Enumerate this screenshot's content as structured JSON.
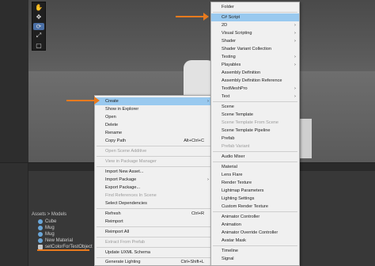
{
  "scene": {
    "tools": [
      "hand-tool-icon",
      "move-tool-icon",
      "rotate-tool-icon",
      "scale-tool-icon",
      "rect-tool-icon",
      "transform-tool-icon"
    ]
  },
  "project": {
    "breadcrumb": "Assets > Models",
    "assets": [
      {
        "name": "Cube",
        "icon": "mesh-icon"
      },
      {
        "name": "Mug",
        "icon": "prefab-icon"
      },
      {
        "name": "Mug",
        "icon": "mesh-icon"
      },
      {
        "name": "New Material",
        "icon": "material-icon"
      },
      {
        "name": "setColorForTestObject",
        "icon": "script-icon"
      }
    ]
  },
  "context_menu": {
    "items": [
      {
        "label": "Create",
        "shortcut": "",
        "submenu": true,
        "disabled": false,
        "highlighted": true
      },
      {
        "label": "Show in Explorer",
        "shortcut": "",
        "submenu": false,
        "disabled": false
      },
      {
        "label": "Open",
        "shortcut": "",
        "submenu": false,
        "disabled": false
      },
      {
        "label": "Delete",
        "shortcut": "",
        "submenu": false,
        "disabled": false
      },
      {
        "label": "Rename",
        "shortcut": "",
        "submenu": false,
        "disabled": false
      },
      {
        "label": "Copy Path",
        "shortcut": "Alt+Ctrl+C",
        "submenu": false,
        "disabled": false
      },
      {
        "label": "Open Scene Additive",
        "shortcut": "",
        "submenu": false,
        "disabled": true
      },
      {
        "label": "View in Package Manager",
        "shortcut": "",
        "submenu": false,
        "disabled": true
      },
      {
        "label": "Import New Asset...",
        "shortcut": "",
        "submenu": false,
        "disabled": false
      },
      {
        "label": "Import Package",
        "shortcut": "",
        "submenu": true,
        "disabled": false
      },
      {
        "label": "Export Package...",
        "shortcut": "",
        "submenu": false,
        "disabled": false
      },
      {
        "label": "Find References In Scene",
        "shortcut": "",
        "submenu": false,
        "disabled": true
      },
      {
        "label": "Select Dependencies",
        "shortcut": "",
        "submenu": false,
        "disabled": false
      },
      {
        "label": "Refresh",
        "shortcut": "Ctrl+R",
        "submenu": false,
        "disabled": false
      },
      {
        "label": "Reimport",
        "shortcut": "",
        "submenu": false,
        "disabled": false
      },
      {
        "label": "Reimport All",
        "shortcut": "",
        "submenu": false,
        "disabled": false
      },
      {
        "label": "Extract From Prefab",
        "shortcut": "",
        "submenu": false,
        "disabled": true
      },
      {
        "label": "Update UXML Schema",
        "shortcut": "",
        "submenu": false,
        "disabled": false
      },
      {
        "label": "Generate Lighting",
        "shortcut": "Ctrl+Shift+L",
        "submenu": false,
        "disabled": false
      }
    ]
  },
  "create_submenu": {
    "items": [
      {
        "label": "Folder",
        "submenu": false,
        "disabled": false
      },
      {
        "label": "C# Script",
        "submenu": false,
        "disabled": false,
        "highlighted": true
      },
      {
        "label": "2D",
        "submenu": true,
        "disabled": false
      },
      {
        "label": "Visual Scripting",
        "submenu": true,
        "disabled": false
      },
      {
        "label": "Shader",
        "submenu": true,
        "disabled": false
      },
      {
        "label": "Shader Variant Collection",
        "submenu": false,
        "disabled": false
      },
      {
        "label": "Testing",
        "submenu": true,
        "disabled": false
      },
      {
        "label": "Playables",
        "submenu": true,
        "disabled": false
      },
      {
        "label": "Assembly Definition",
        "submenu": false,
        "disabled": false
      },
      {
        "label": "Assembly Definition Reference",
        "submenu": false,
        "disabled": false
      },
      {
        "label": "TextMeshPro",
        "submenu": true,
        "disabled": false
      },
      {
        "label": "Text",
        "submenu": true,
        "disabled": false
      },
      {
        "label": "Scene",
        "submenu": false,
        "disabled": false
      },
      {
        "label": "Scene Template",
        "submenu": false,
        "disabled": false
      },
      {
        "label": "Scene Template From Scene",
        "submenu": false,
        "disabled": true
      },
      {
        "label": "Scene Template Pipeline",
        "submenu": false,
        "disabled": false
      },
      {
        "label": "Prefab",
        "submenu": false,
        "disabled": false
      },
      {
        "label": "Prefab Variant",
        "submenu": false,
        "disabled": true
      },
      {
        "label": "Audio Mixer",
        "submenu": false,
        "disabled": false
      },
      {
        "label": "Material",
        "submenu": false,
        "disabled": false
      },
      {
        "label": "Lens Flare",
        "submenu": false,
        "disabled": false
      },
      {
        "label": "Render Texture",
        "submenu": false,
        "disabled": false
      },
      {
        "label": "Lightmap Parameters",
        "submenu": false,
        "disabled": false
      },
      {
        "label": "Lighting Settings",
        "submenu": false,
        "disabled": false
      },
      {
        "label": "Custom Render Texture",
        "submenu": false,
        "disabled": false
      },
      {
        "label": "Animator Controller",
        "submenu": false,
        "disabled": false
      },
      {
        "label": "Animation",
        "submenu": false,
        "disabled": false
      },
      {
        "label": "Animator Override Controller",
        "submenu": false,
        "disabled": false
      },
      {
        "label": "Avatar Mask",
        "submenu": false,
        "disabled": false
      },
      {
        "label": "Timeline",
        "submenu": false,
        "disabled": false
      },
      {
        "label": "Signal",
        "submenu": false,
        "disabled": false
      }
    ]
  },
  "colors": {
    "accent_arrow": "#e87a1e",
    "menu_highlight": "#99c9ef",
    "menu_background": "#f0f0f0"
  }
}
